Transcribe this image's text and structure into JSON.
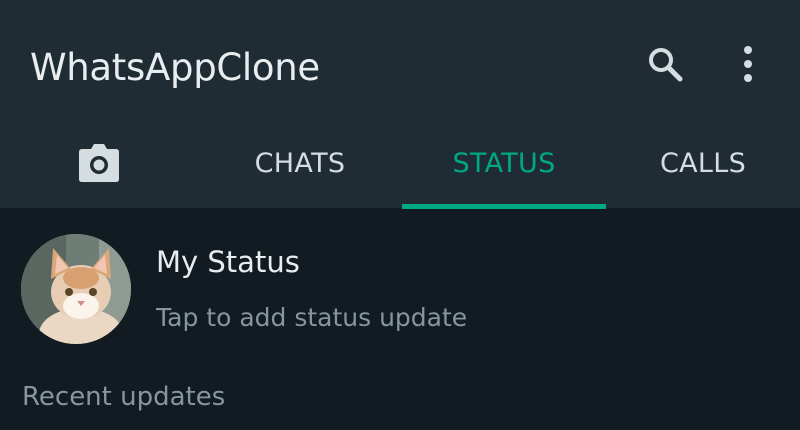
{
  "app_bar": {
    "title": "WhatsAppClone",
    "search_icon": "search-icon",
    "menu_icon": "more-vert-icon",
    "background": "#1f2c34"
  },
  "tabs": [
    {
      "label": "",
      "icon": "camera-icon",
      "active": false
    },
    {
      "label": "CHATS",
      "active": false
    },
    {
      "label": "STATUS",
      "active": true
    },
    {
      "label": "CALLS",
      "active": false
    }
  ],
  "my_status": {
    "name": "My Status",
    "subtitle": "Tap to add status update",
    "avatar": "cat-avatar"
  },
  "recent_updates_label": "Recent updates",
  "colors": {
    "accent": "#00a884",
    "background": "#111b21",
    "primary_text": "#e9edef",
    "secondary_text": "#8696a0"
  }
}
